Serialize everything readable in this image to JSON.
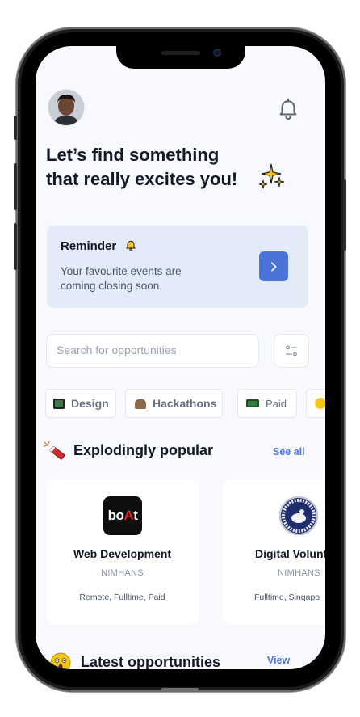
{
  "header": {
    "headline_line1": "Let’s find something",
    "headline_line2": "that really excites you!"
  },
  "reminder": {
    "title": "Reminder",
    "text_line1": "Your favourite events are",
    "text_line2": "coming closing soon."
  },
  "search": {
    "placeholder": "Search for opportunities"
  },
  "categories": [
    {
      "label": "Design"
    },
    {
      "label": "Hackathons"
    },
    {
      "label": "Paid"
    }
  ],
  "popular": {
    "title": "Explodingly popular",
    "see_all": "See all",
    "cards": [
      {
        "title": "Web Development",
        "org": "NIMHANS",
        "meta": "Remote, Fulltime, Paid",
        "logo_text": "boAt"
      },
      {
        "title": "Digital Volunt",
        "org": "NIMHANS",
        "meta": "Fulltime, Singapo"
      }
    ]
  },
  "latest": {
    "title": "Latest opportunities",
    "view": "View"
  },
  "colors": {
    "accent": "#4c74d8",
    "background": "#f7f9fd",
    "reminder_bg": "#e4ebf8"
  }
}
